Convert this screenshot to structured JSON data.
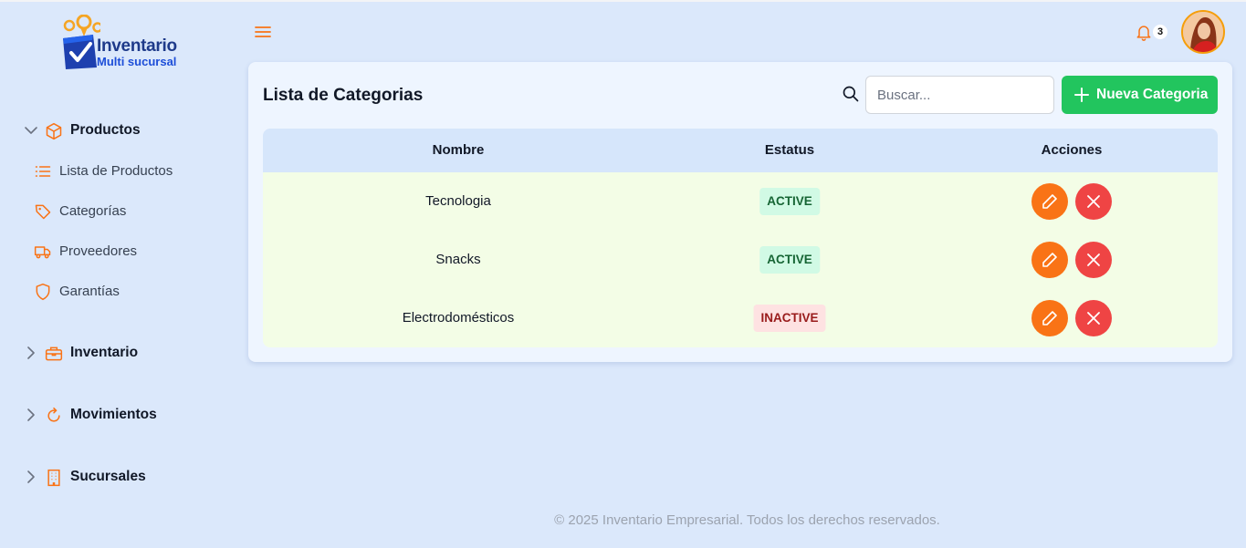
{
  "brand": {
    "title": "Inventario",
    "subtitle": "Multi sucursal"
  },
  "sidebar": {
    "groups": [
      {
        "label": "Productos",
        "icon": "box-icon",
        "expanded": true,
        "items": [
          {
            "label": "Lista de Productos",
            "icon": "list-icon"
          },
          {
            "label": "Categorías",
            "icon": "tag-icon"
          },
          {
            "label": "Proveedores",
            "icon": "truck-icon"
          },
          {
            "label": "Garantías",
            "icon": "shield-icon"
          }
        ]
      },
      {
        "label": "Inventario",
        "icon": "briefcase-icon",
        "expanded": false
      },
      {
        "label": "Movimientos",
        "icon": "refresh-icon",
        "expanded": false
      },
      {
        "label": "Sucursales",
        "icon": "building-icon",
        "expanded": false
      }
    ]
  },
  "header": {
    "notifications_count": "3"
  },
  "main": {
    "title": "Lista de Categorias",
    "search_placeholder": "Buscar...",
    "new_button_label": "Nueva Categoria",
    "columns": [
      "Nombre",
      "Estatus",
      "Acciones"
    ],
    "rows": [
      {
        "name": "Tecnologia",
        "status": "ACTIVE"
      },
      {
        "name": "Snacks",
        "status": "ACTIVE"
      },
      {
        "name": "Electrodomésticos",
        "status": "INACTIVE"
      }
    ]
  },
  "footer": {
    "text": "© 2025 Inventario Empresarial. Todos los derechos reservados."
  },
  "colors": {
    "background": "#dbe8fb",
    "accent_orange": "#f97316",
    "accent_green": "#22c55e",
    "danger_red": "#ef4444",
    "brand_blue": "#1e3a8a"
  }
}
